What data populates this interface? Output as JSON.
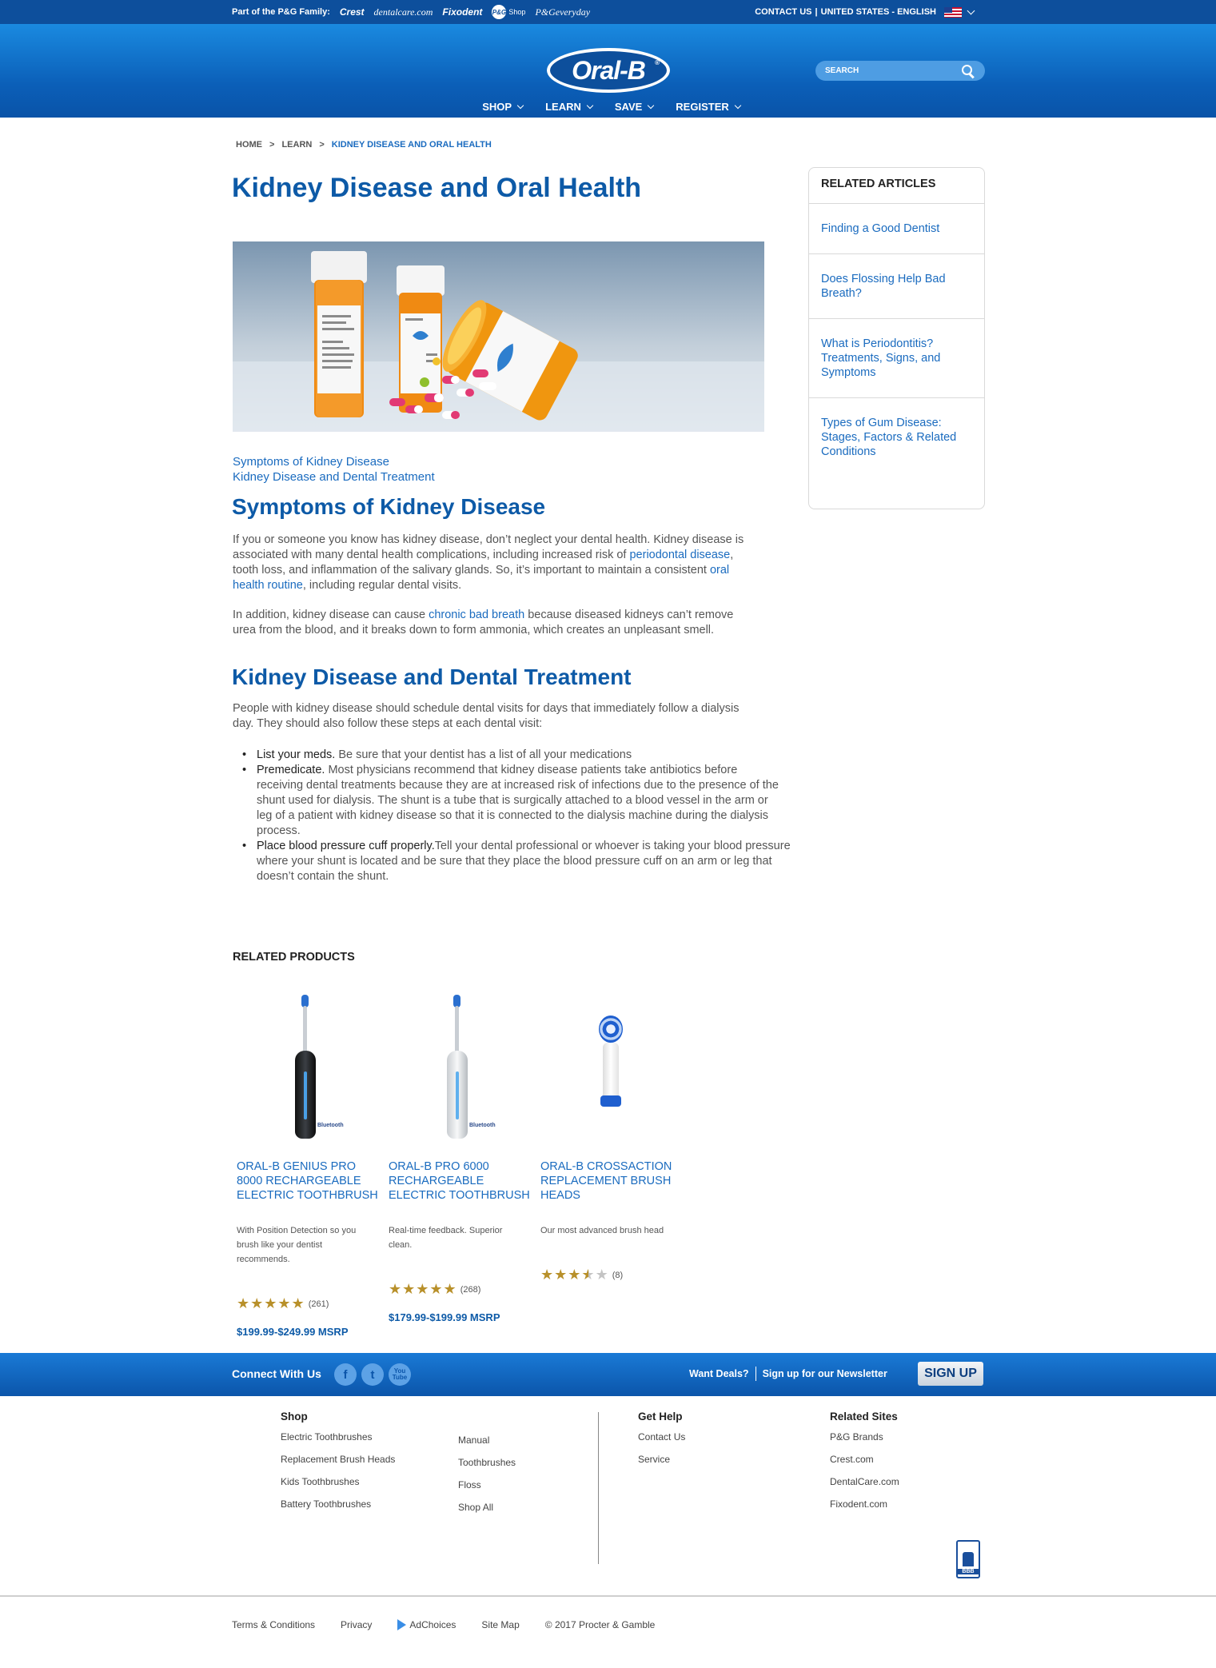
{
  "topbar": {
    "family_label": "Part of the P&G Family:",
    "brands": [
      "Crest",
      "dentalcare.com",
      "Fixodent",
      "Shop",
      "P&Geveryday"
    ],
    "pg_badge": "P&G",
    "contact": "CONTACT US",
    "region": "UNITED STATES - ENGLISH"
  },
  "header": {
    "logo": "Oral-B",
    "logo_mark": "®",
    "search_placeholder": "SEARCH",
    "nav": [
      "SHOP",
      "LEARN",
      "SAVE",
      "REGISTER"
    ]
  },
  "breadcrumb": [
    "HOME",
    ">",
    "LEARN",
    ">",
    "KIDNEY DISEASE AND ORAL HEALTH"
  ],
  "article": {
    "title": "Kidney Disease and Oral Health",
    "toc": [
      "Symptoms of Kidney Disease",
      "Kidney Disease and Dental Treatment"
    ],
    "section1": {
      "heading": "Symptoms of Kidney Disease",
      "p1_a": "If you or someone you know has kidney disease, don’t neglect your dental health. Kidney disease is associated with many dental health complications, including increased risk of ",
      "p1_link1": "periodontal disease",
      "p1_b": ", tooth loss, and inflammation of the salivary glands. So, it’s important to maintain a consistent ",
      "p1_link2": "oral health routine",
      "p1_c": ", including regular dental visits.",
      "p2_a": "In addition, kidney disease can cause ",
      "p2_link": "chronic bad breath",
      "p2_b": " because diseased kidneys can’t remove urea from the blood, and it breaks down to form ammonia, which creates an unpleasant smell."
    },
    "section2": {
      "heading": "Kidney Disease and Dental Treatment",
      "intro": "People with kidney disease should schedule dental visits for days that immediately follow a dialysis day. They should also follow these steps at each dental visit:",
      "bullets": [
        {
          "lead": "List your meds.",
          "text": " Be sure that your dentist has a list of all your medications"
        },
        {
          "lead": "Premedicate.",
          "text": " Most physicians recommend that kidney disease patients take antibiotics before receiving dental treatments because they are at increased risk of infections due to the presence of the shunt used for dialysis. The shunt is a tube that is surgically attached to a blood vessel in the arm or leg of a patient with kidney disease so that it is connected to the dialysis machine during the dialysis process."
        },
        {
          "lead": "Place blood pressure cuff properly.",
          "text": "Tell your dental professional or whoever is taking your blood pressure where your shunt is located and be sure that they place the blood pressure cuff on an arm or leg that doesn’t contain the shunt."
        }
      ]
    }
  },
  "related_articles": {
    "heading": "RELATED ARTICLES",
    "items": [
      "Finding a Good Dentist",
      "Does Flossing Help Bad Breath?",
      "What is Periodontitis? Treatments, Signs, and Symptoms",
      "Types of Gum Disease: Stages, Factors & Related Conditions"
    ]
  },
  "related_products": {
    "heading": "RELATED PRODUCTS",
    "items": [
      {
        "name": "ORAL-B GENIUS PRO 8000 RECHARGEABLE ELECTRIC TOOTHBRUSH",
        "desc": "With Position Detection so you brush like your dentist recommends.",
        "stars": 5,
        "count": "(261)",
        "price": "$199.99-$249.99 MSRP",
        "bt_label": "Bluetooth"
      },
      {
        "name": "ORAL-B PRO 6000 RECHARGEABLE ELECTRIC TOOTHBRUSH",
        "desc": "Real-time feedback. Superior clean.",
        "stars": 5,
        "count": "(268)",
        "price": "$179.99-$199.99 MSRP",
        "bt_label": "Bluetooth"
      },
      {
        "name": "ORAL-B CROSSACTION REPLACEMENT BRUSH HEADS",
        "desc": "Our most advanced brush head",
        "stars": 3.5,
        "count": "(8)",
        "price": ""
      }
    ]
  },
  "footer": {
    "connect": "Connect With Us",
    "social": [
      "f",
      "t",
      "You Tube"
    ],
    "deals": "Want Deals?",
    "newsletter": "Sign up for our Newsletter",
    "signup": "SIGN UP",
    "shop_heading": "Shop",
    "shop_col1": [
      "Electric Toothbrushes",
      "Replacement Brush Heads",
      "Kids Toothbrushes",
      "Battery Toothbrushes"
    ],
    "shop_col2": [
      "Manual",
      "Toothbrushes",
      "Floss",
      "Shop All"
    ],
    "help_heading": "Get Help",
    "help_links": [
      "Contact Us",
      "Service"
    ],
    "sites_heading": "Related Sites",
    "sites_links": [
      "P&G Brands",
      "Crest.com",
      "DentalCare.com",
      "Fixodent.com"
    ],
    "bbb": "BBB",
    "legal": [
      "Terms & Conditions",
      "Privacy",
      "AdChoices",
      "Site Map",
      "© 2017 Procter & Gamble"
    ]
  },
  "colors": {
    "brand_blue": "#0d4f9c",
    "link_blue": "#1a6bbf",
    "heading_blue": "#0d5aa7",
    "star_gold": "#b8902a"
  }
}
